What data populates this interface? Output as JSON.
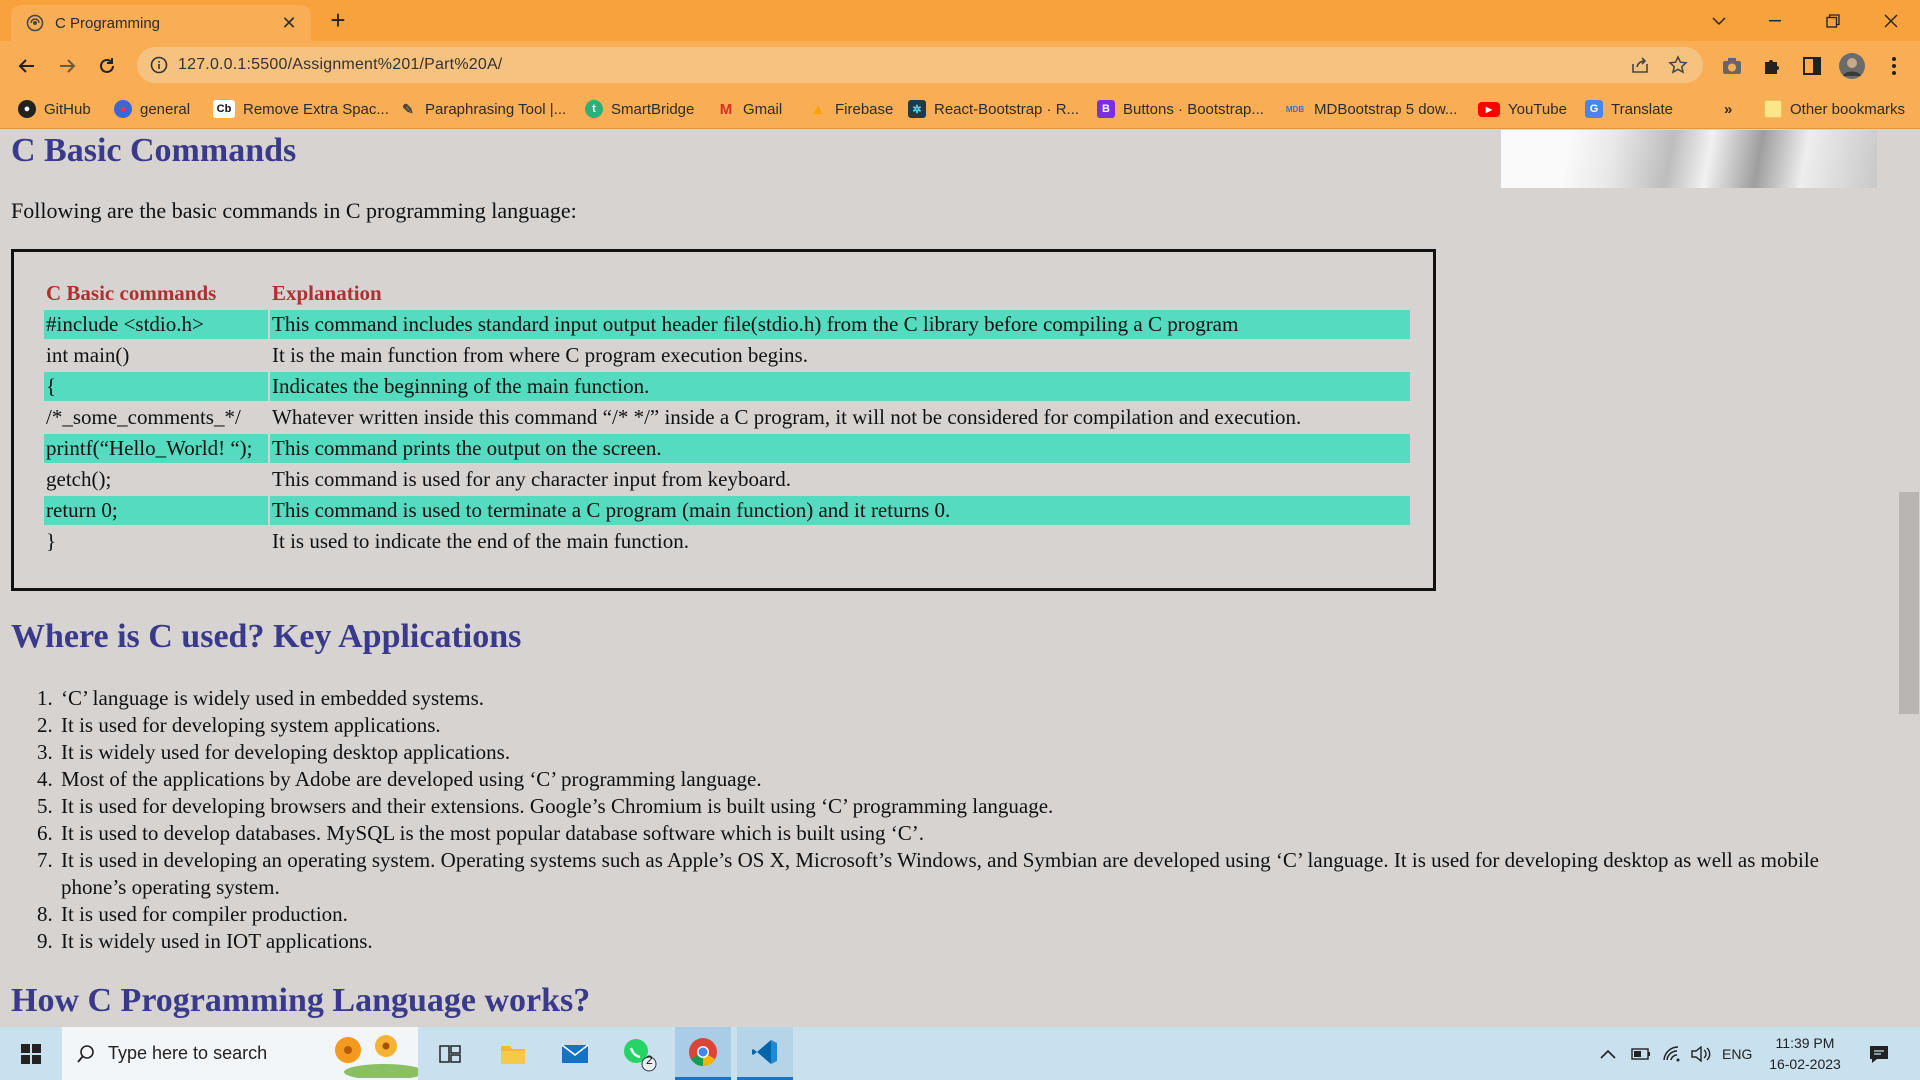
{
  "browser": {
    "tab_title": "C Programming",
    "new_tab": "+",
    "url": "127.0.0.1:5500/Assignment%201/Part%20A/",
    "window_controls": [
      "minimize",
      "restore",
      "close"
    ],
    "bookmarks": [
      {
        "label": "GitHub",
        "icon": "github-icon"
      },
      {
        "label": "general",
        "icon": "general-icon"
      },
      {
        "label": "Remove Extra Spac...",
        "icon": "cb-icon"
      },
      {
        "label": "Paraphrasing Tool |...",
        "icon": "quill-icon"
      },
      {
        "label": "SmartBridge",
        "icon": "smartbridge-icon"
      },
      {
        "label": "Gmail",
        "icon": "gmail-icon"
      },
      {
        "label": "Firebase",
        "icon": "firebase-icon"
      },
      {
        "label": "React-Bootstrap · R...",
        "icon": "react-icon"
      },
      {
        "label": "Buttons · Bootstrap...",
        "icon": "bootstrap-icon"
      },
      {
        "label": "MDBootstrap 5 dow...",
        "icon": "mdb-icon"
      },
      {
        "label": "YouTube",
        "icon": "youtube-icon"
      },
      {
        "label": "Translate",
        "icon": "translate-icon"
      }
    ],
    "more_bookmarks": "»",
    "other_bookmarks": "Other bookmarks"
  },
  "page": {
    "section1_title": "C Basic Commands",
    "intro": "Following are the basic commands in C programming language:",
    "table": {
      "headers": [
        "C Basic commands",
        "Explanation"
      ],
      "rows": [
        {
          "command": "#include <stdio.h>",
          "explanation": "This command includes standard input output header file(stdio.h) from the C library before compiling a C program",
          "highlight": true
        },
        {
          "command": "int main()",
          "explanation": "It is the main function from where C program execution begins.",
          "highlight": false
        },
        {
          "command": "{",
          "explanation": "Indicates the beginning of the main function.",
          "highlight": true
        },
        {
          "command": "/*_some_comments_*/",
          "explanation": "Whatever written inside this command “/* */” inside a C program, it will not be considered for compilation and execution.",
          "highlight": false
        },
        {
          "command": "printf(“Hello_World! “);",
          "explanation": "This command prints the output on the screen.",
          "highlight": true
        },
        {
          "command": "getch();",
          "explanation": "This command is used for any character input from keyboard.",
          "highlight": false
        },
        {
          "command": "return 0;",
          "explanation": "This command is used to terminate a C program (main function) and it returns 0.",
          "highlight": true
        },
        {
          "command": "}",
          "explanation": "It is used to indicate the end of the main function.",
          "highlight": false
        }
      ]
    },
    "section2_title": "Where is C used? Key Applications",
    "applications": [
      "‘C’ language is widely used in embedded systems.",
      "It is used for developing system applications.",
      "It is widely used for developing desktop applications.",
      "Most of the applications by Adobe are developed using ‘C’ programming language.",
      "It is used for developing browsers and their extensions. Google’s Chromium is built using ‘C’ programming language.",
      "It is used to develop databases. MySQL is the most popular database software which is built using ‘C’.",
      "It is used in developing an operating system. Operating systems such as Apple’s OS X, Microsoft’s Windows, and Symbian are developed using ‘C’ language. It is used for developing desktop as well as mobile phone’s operating system.",
      "It is used for compiler production.",
      "It is widely used in IOT applications."
    ],
    "section3_title": "How C Programming Language works?"
  },
  "taskbar": {
    "search_placeholder": "Type here to search",
    "whatsapp_badge": "2",
    "language": "ENG",
    "time": "11:39 PM",
    "date": "16-02-2023"
  },
  "colors": {
    "tab_bar": "#f7a23c",
    "toolbar": "#f9ad54",
    "page_bg": "#d6d3d1",
    "heading": "#3a3a8a",
    "table_header": "#b03030",
    "row_highlight": "#55dbbf"
  }
}
